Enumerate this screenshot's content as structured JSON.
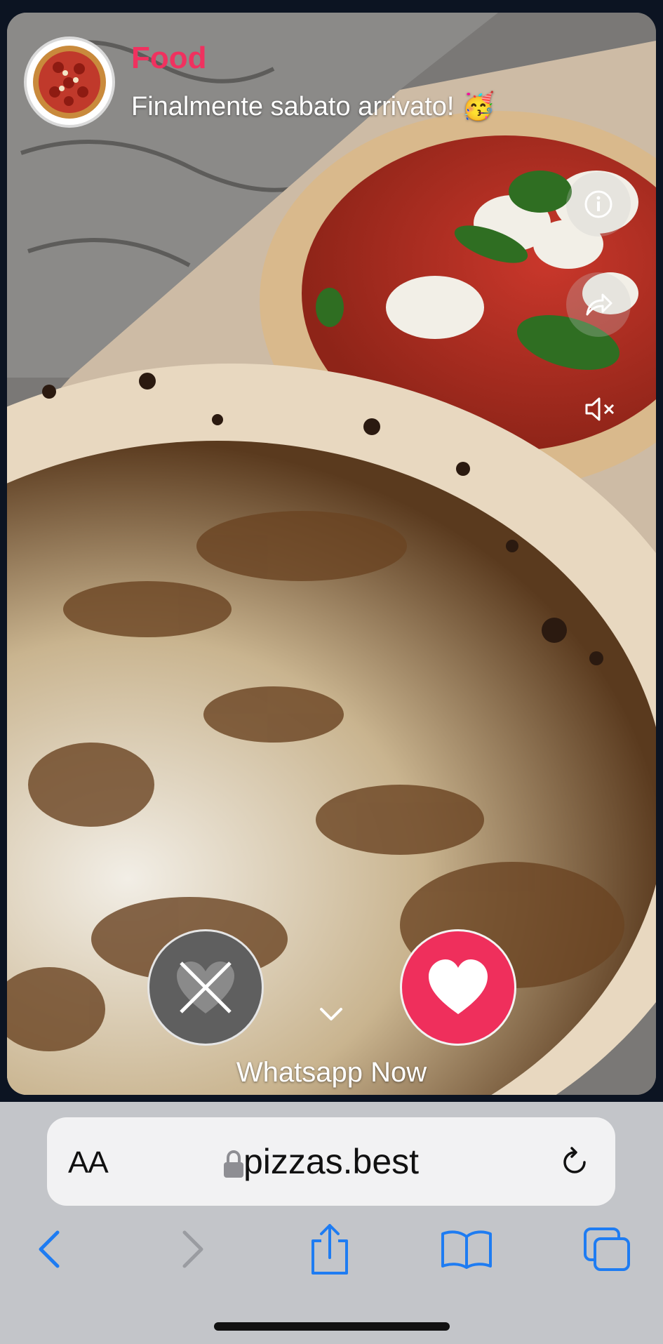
{
  "post": {
    "category": "Food",
    "caption": "Finalmente sabato arrivato! 🥳",
    "cta": "Whatsapp Now"
  },
  "actions": {
    "dislike": "dislike",
    "like": "like"
  },
  "browser": {
    "text_size_label": "AA",
    "domain": "pizzas.best"
  },
  "colors": {
    "accent": "#ef2f5c",
    "ios_blue": "#1e7cf2"
  },
  "icons": [
    "info-icon",
    "share-icon",
    "mute-icon",
    "close-icon",
    "heart-icon",
    "chevron-down-icon",
    "lock-icon",
    "reload-icon",
    "back-icon",
    "forward-icon",
    "share-sheet-icon",
    "bookmarks-icon",
    "tabs-icon"
  ]
}
